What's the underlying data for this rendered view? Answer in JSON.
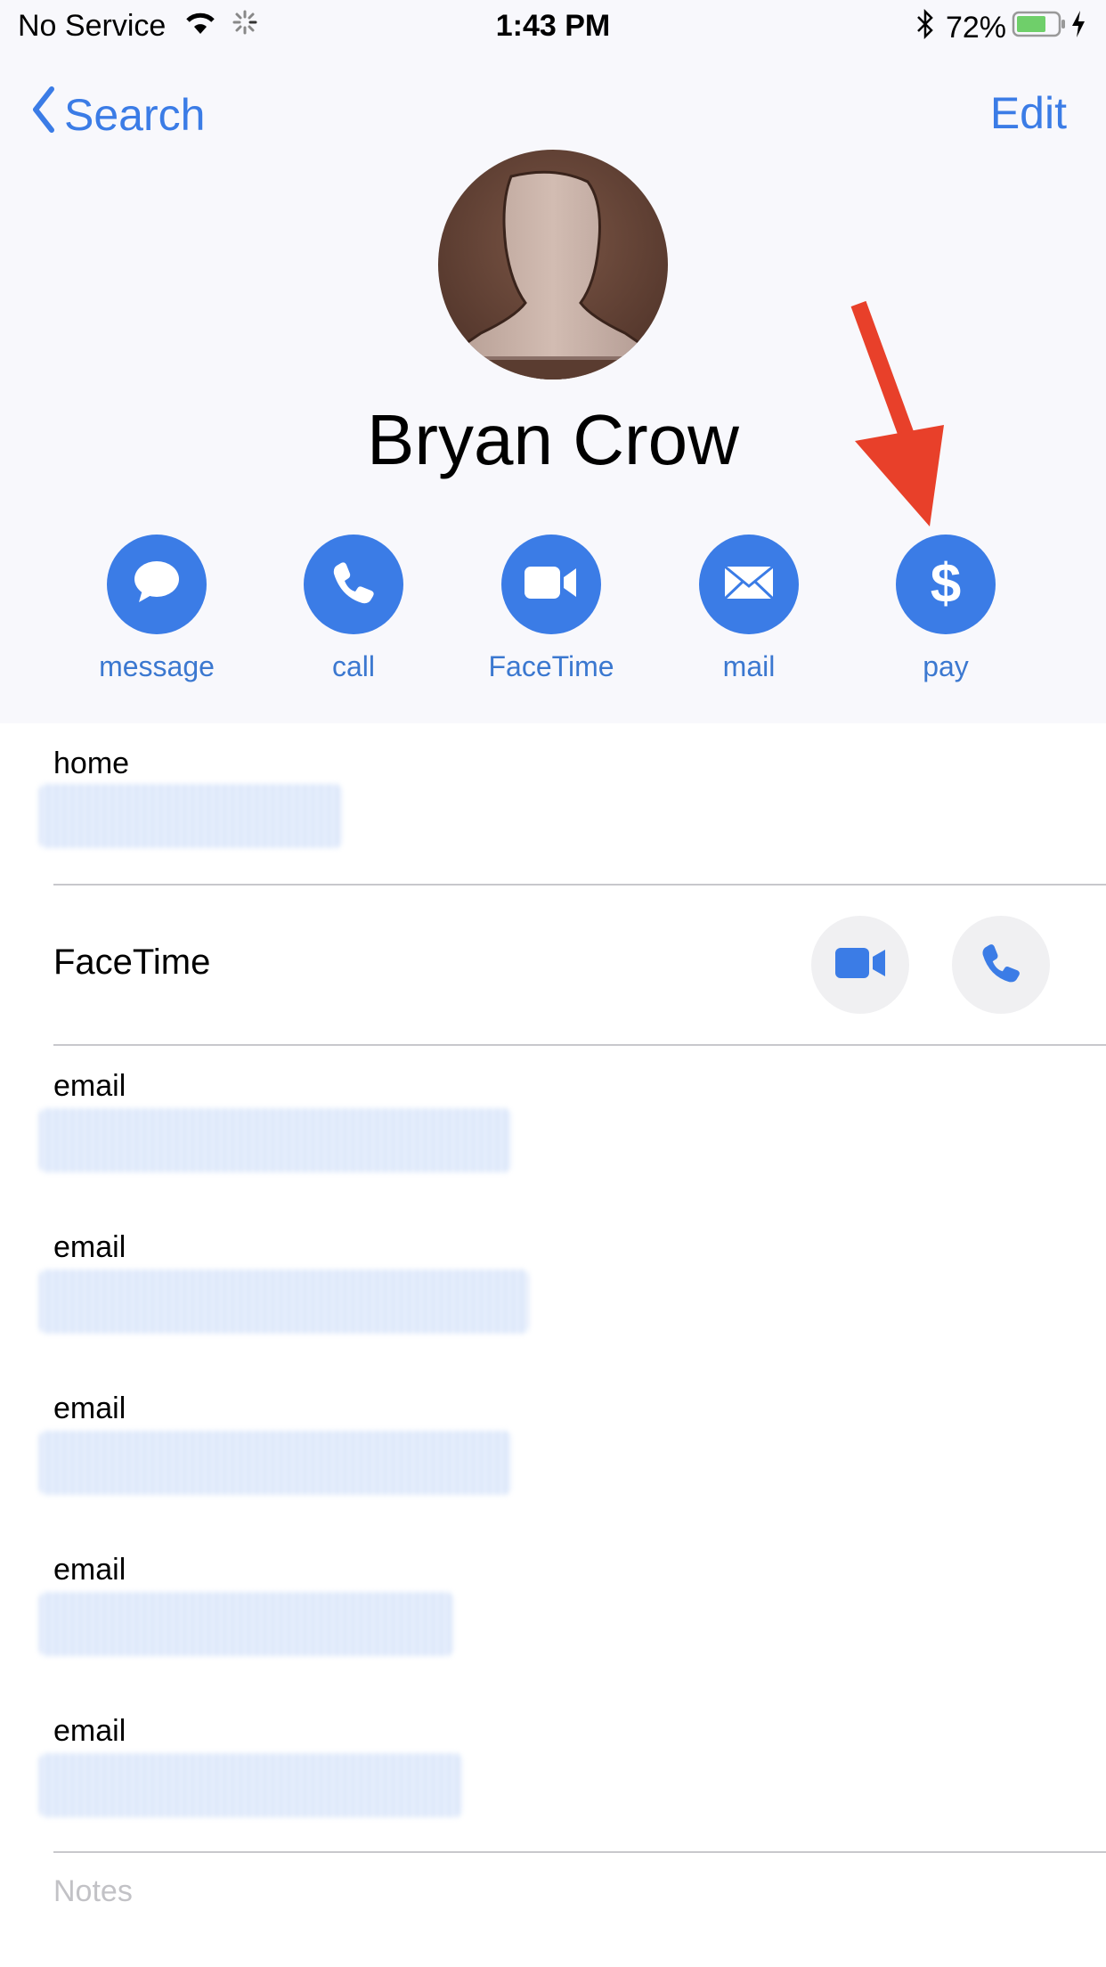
{
  "status_bar": {
    "carrier": "No Service",
    "time": "1:43 PM",
    "battery_percent": "72%",
    "battery_level": 0.72,
    "icons": [
      "wifi-icon",
      "activity-spinner-icon",
      "bluetooth-icon",
      "battery-icon",
      "charging-bolt-icon"
    ]
  },
  "nav": {
    "back_label": "Search",
    "edit_label": "Edit"
  },
  "contact": {
    "name": "Bryan Crow"
  },
  "actions": [
    {
      "label": "message",
      "icon": "message-bubble-icon"
    },
    {
      "label": "call",
      "icon": "phone-icon"
    },
    {
      "label": "FaceTime",
      "icon": "video-camera-icon"
    },
    {
      "label": "mail",
      "icon": "envelope-icon"
    },
    {
      "label": "pay",
      "icon": "dollar-icon"
    }
  ],
  "annotation": {
    "arrow_target": "pay",
    "arrow_color": "#e8402a"
  },
  "fields": {
    "home_label": "home",
    "facetime_label": "FaceTime",
    "emails": [
      {
        "label": "email"
      },
      {
        "label": "email"
      },
      {
        "label": "email"
      },
      {
        "label": "email"
      },
      {
        "label": "email"
      }
    ],
    "notes_placeholder": "Notes"
  },
  "colors": {
    "accent": "#3b7ce6",
    "header_bg": "#f8f8fc",
    "separator": "#c8c8cc",
    "battery_fill": "#6fcf6a"
  }
}
